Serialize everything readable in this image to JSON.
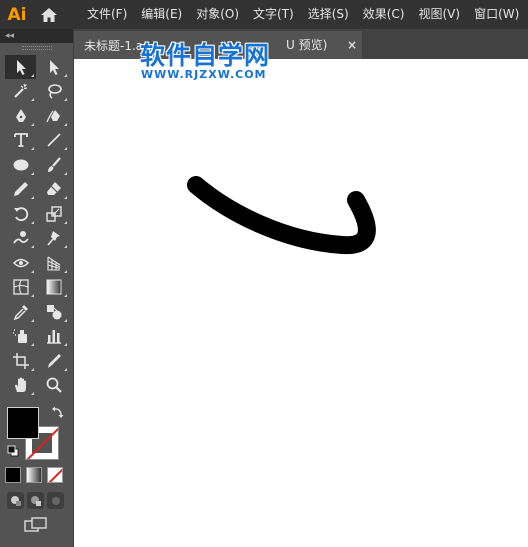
{
  "app": {
    "logo_text": "Ai",
    "accent_color": "#ff9a00"
  },
  "menu": {
    "items": [
      {
        "label": "文件(F)"
      },
      {
        "label": "编辑(E)"
      },
      {
        "label": "对象(O)"
      },
      {
        "label": "文字(T)"
      },
      {
        "label": "选择(S)"
      },
      {
        "label": "效果(C)"
      },
      {
        "label": "视图(V)"
      },
      {
        "label": "窗口(W)"
      }
    ]
  },
  "toolbar": {
    "collapse_label": "◂◂",
    "tools": [
      {
        "name": "selection-tool",
        "icon": "arrow-solid-icon",
        "active": true
      },
      {
        "name": "direct-selection-tool",
        "icon": "arrow-hollow-icon"
      },
      {
        "name": "magic-wand-tool",
        "icon": "magic-wand-icon"
      },
      {
        "name": "lasso-tool",
        "icon": "lasso-icon"
      },
      {
        "name": "pen-tool",
        "icon": "pen-icon"
      },
      {
        "name": "curvature-tool",
        "icon": "curvature-pen-icon"
      },
      {
        "name": "type-tool",
        "icon": "type-icon"
      },
      {
        "name": "line-segment-tool",
        "icon": "line-icon"
      },
      {
        "name": "ellipse-tool",
        "icon": "ellipse-icon"
      },
      {
        "name": "paintbrush-tool",
        "icon": "brush-icon"
      },
      {
        "name": "pencil-tool",
        "icon": "pencil-icon"
      },
      {
        "name": "eraser-tool",
        "icon": "eraser-icon"
      },
      {
        "name": "rotate-tool",
        "icon": "rotate-icon"
      },
      {
        "name": "scale-tool",
        "icon": "scale-icon"
      },
      {
        "name": "warp-tool",
        "icon": "warp-icon"
      },
      {
        "name": "puppet-warp-tool",
        "icon": "pin-icon"
      },
      {
        "name": "free-transform-tool",
        "icon": "free-transform-icon"
      },
      {
        "name": "perspective-grid-tool",
        "icon": "perspective-grid-icon"
      },
      {
        "name": "mesh-tool",
        "icon": "mesh-icon"
      },
      {
        "name": "gradient-tool",
        "icon": "gradient-icon"
      },
      {
        "name": "eyedropper-tool",
        "icon": "eyedropper-icon"
      },
      {
        "name": "blend-tool",
        "icon": "shape-builder-icon"
      },
      {
        "name": "symbol-sprayer-tool",
        "icon": "symbol-sprayer-icon"
      },
      {
        "name": "column-graph-tool",
        "icon": "bar-graph-icon"
      },
      {
        "name": "artboard-tool",
        "icon": "artboard-icon"
      },
      {
        "name": "slice-tool",
        "icon": "knife-icon"
      },
      {
        "name": "hand-tool",
        "icon": "hand-icon"
      },
      {
        "name": "zoom-tool",
        "icon": "zoom-icon"
      }
    ],
    "fill_color": "#000000",
    "stroke_color": "none"
  },
  "document": {
    "tab_title": "未标题-1.a",
    "tab_title_tail": "U 预览)",
    "close_label": "×"
  },
  "watermark": {
    "title": "软件自学网",
    "url": "WWW.RJZXW.COM",
    "color": "#1673d6"
  },
  "canvas": {
    "background": "#ffffff",
    "stroke_color": "#000000"
  }
}
